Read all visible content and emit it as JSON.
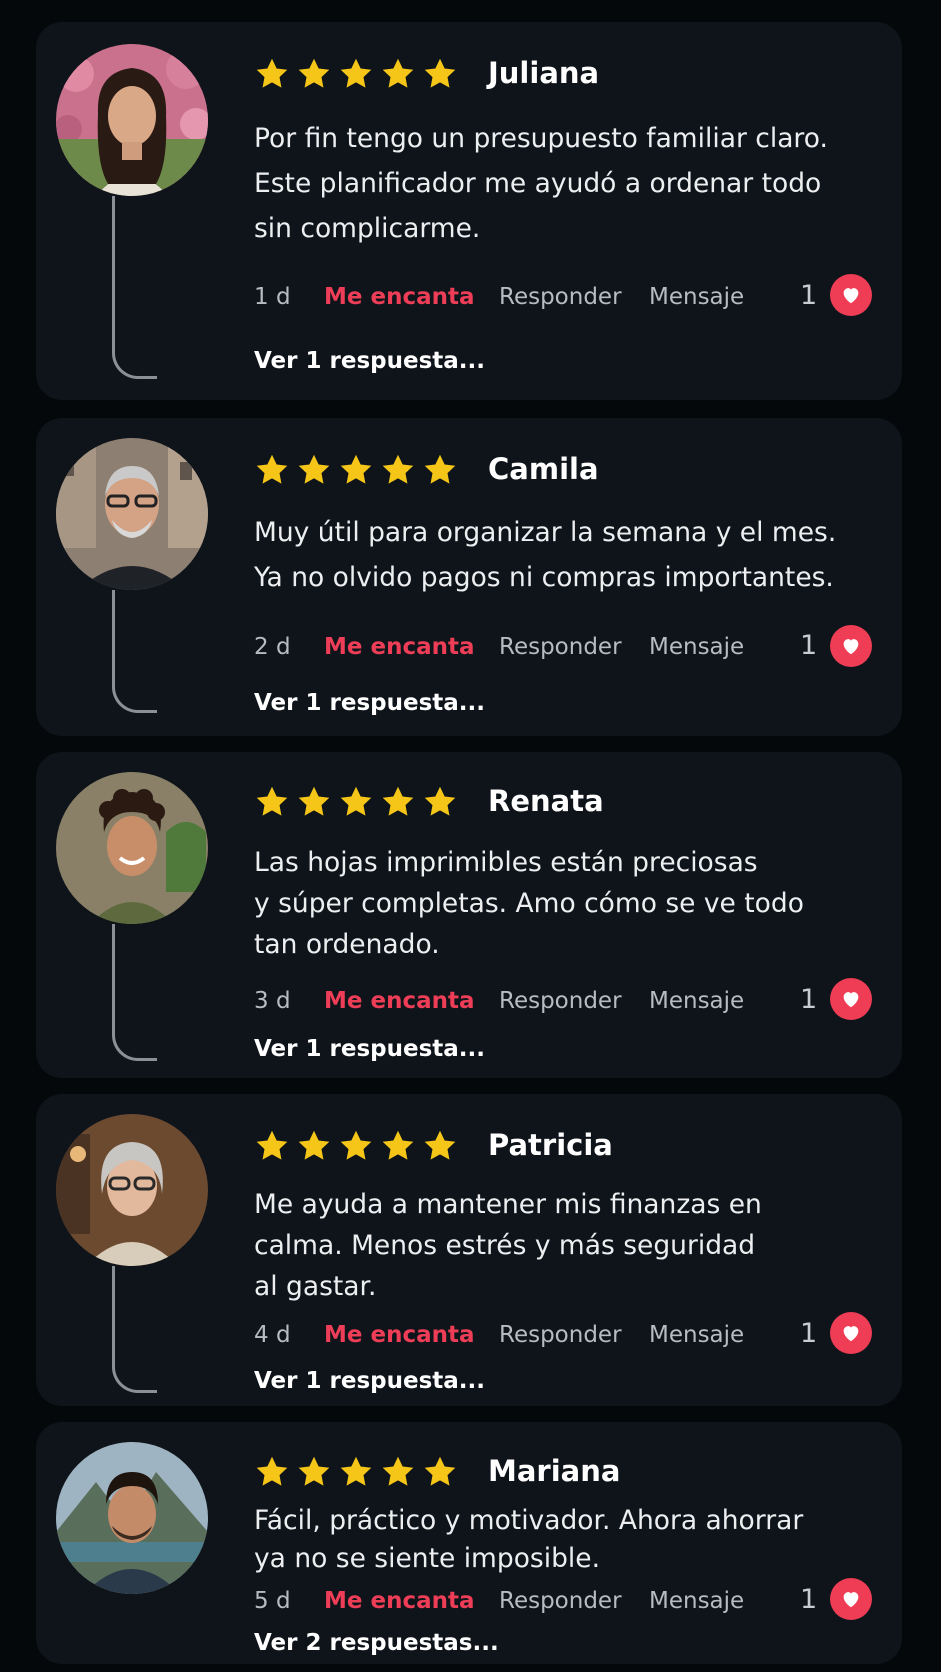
{
  "colors": {
    "background": "#05080b",
    "card": "#0e141a",
    "star": "#f5c518",
    "accent_red": "#ef3d55",
    "muted_text": "#b8bcc0"
  },
  "icons": {
    "star": "star-icon",
    "heart": "heart-icon",
    "thread": "reply-thread-connector"
  },
  "reviews": [
    {
      "name": "Juliana",
      "stars": 5,
      "text": "Por fin tengo un presupuesto familiar claro.\nEste planificador me ayudó a ordenar todo\nsin complicarme.",
      "time": "1 d",
      "love_label": "Me encanta",
      "reply_label": "Responder",
      "message_label": "Mensaje",
      "likes": "1",
      "view_replies": "Ver 1 respuesta..."
    },
    {
      "name": "Camila",
      "stars": 5,
      "text": "Muy útil para organizar la semana y el mes.\nYa no olvido pagos ni compras importantes.",
      "time": "2 d",
      "love_label": "Me encanta",
      "reply_label": "Responder",
      "message_label": "Mensaje",
      "likes": "1",
      "view_replies": "Ver 1 respuesta..."
    },
    {
      "name": "Renata",
      "stars": 5,
      "text": "Las hojas imprimibles están preciosas\ny súper completas. Amo cómo se ve todo\ntan ordenado.",
      "time": "3 d",
      "love_label": "Me encanta",
      "reply_label": "Responder",
      "message_label": "Mensaje",
      "likes": "1",
      "view_replies": "Ver 1 respuesta..."
    },
    {
      "name": "Patricia",
      "stars": 5,
      "text": "Me ayuda a mantener mis finanzas en\ncalma. Menos estrés y más seguridad\nal gastar.",
      "time": "4 d",
      "love_label": "Me encanta",
      "reply_label": "Responder",
      "message_label": "Mensaje",
      "likes": "1",
      "view_replies": "Ver 1 respuesta..."
    },
    {
      "name": "Mariana",
      "stars": 5,
      "text": "Fácil, práctico y motivador. Ahora ahorrar\nya no se siente imposible.",
      "time": "5 d",
      "love_label": "Me encanta",
      "reply_label": "Responder",
      "message_label": "Mensaje",
      "likes": "1",
      "view_replies": "Ver 2 respuestas..."
    }
  ]
}
